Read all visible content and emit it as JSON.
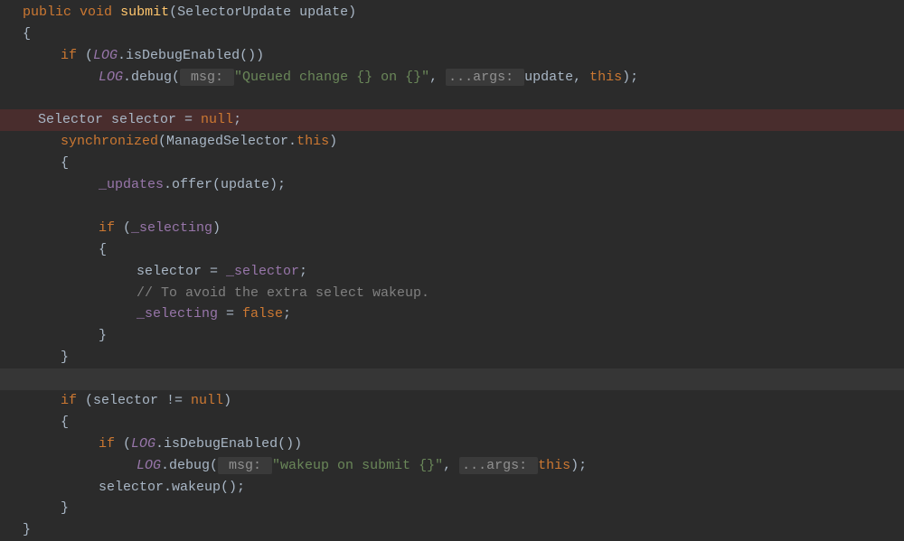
{
  "signature": {
    "pub": "public",
    "void": "void",
    "name": "submit",
    "paramType": "SelectorUpdate ",
    "paramName": "update"
  },
  "line1": {
    "braceOpen": "{"
  },
  "line2": {
    "if": "if",
    "open": " (",
    "log": "LOG",
    "call": ".isDebugEnabled())"
  },
  "line3": {
    "log": "LOG",
    "dot": ".debug(",
    "hint1": " msg: ",
    "str": "\"Queued change {} on {}\"",
    "comma": ", ",
    "hint2": " ...args: ",
    "args": "update, ",
    "this": "this",
    "end": ");"
  },
  "line4": {
    "type": "Selector ",
    "var": "selector = ",
    "null": "null",
    "semi": ";"
  },
  "line5": {
    "sync": "synchronized",
    "open": "(ManagedSelector.",
    "this": "this",
    "close": ")"
  },
  "line6": {
    "brace": "{"
  },
  "line7": {
    "field": "_updates",
    "call": ".offer(update);"
  },
  "line8": {
    "if": "if",
    "open": " (",
    "field": "_selecting",
    "close": ")"
  },
  "line9": {
    "brace": "{"
  },
  "line10": {
    "lhs": "selector = ",
    "field": "_selector",
    "semi": ";"
  },
  "line11": {
    "comment": "// To avoid the extra select wakeup."
  },
  "line12": {
    "field": "_selecting",
    "eq": " = ",
    "false": "false",
    "semi": ";"
  },
  "line13": {
    "brace": "}"
  },
  "line14": {
    "brace": "}"
  },
  "line15": {
    "if": "if",
    "open": " (selector != ",
    "null": "null",
    "close": ")"
  },
  "line16": {
    "brace": "{"
  },
  "line17": {
    "if": "if",
    "open": " (",
    "log": "LOG",
    "call": ".isDebugEnabled())"
  },
  "line18": {
    "log": "LOG",
    "dot": ".debug(",
    "hint1": " msg: ",
    "str": "\"wakeup on submit {}\"",
    "comma": ", ",
    "hint2": " ...args: ",
    "this": "this",
    "end": ");"
  },
  "line19": {
    "call": "selector.wakeup();"
  },
  "line20": {
    "brace": "}"
  },
  "line21": {
    "brace": "}"
  }
}
